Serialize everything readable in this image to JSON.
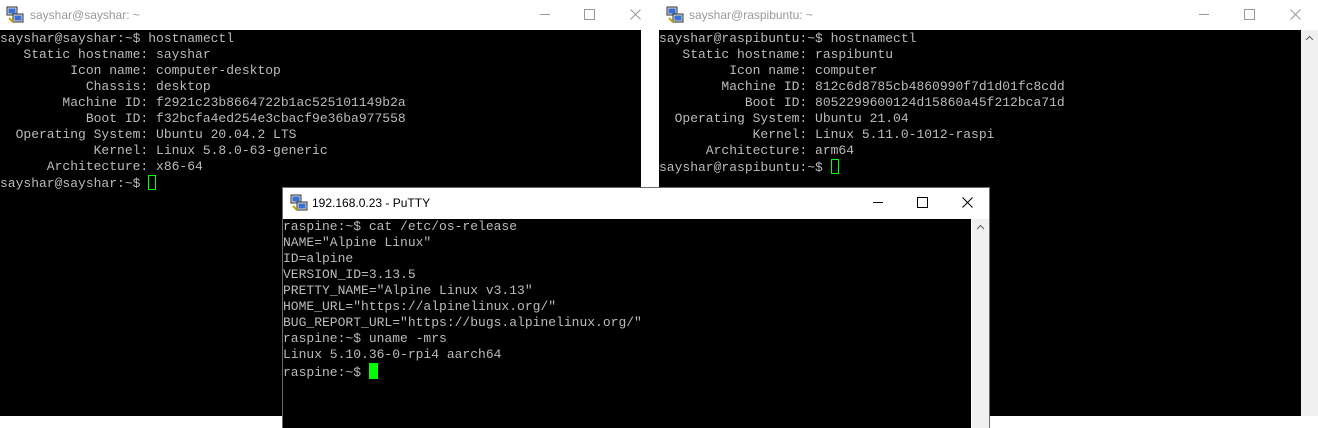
{
  "windows": {
    "left": {
      "title": "sayshar@sayshar: ~",
      "lines": [
        "sayshar@sayshar:~$ hostnamectl",
        "   Static hostname: sayshar",
        "         Icon name: computer-desktop",
        "           Chassis: desktop",
        "        Machine ID: f2921c23b8664722b1ac525101149b2a",
        "           Boot ID: f32bcfa4ed254e3cbacf9e36ba977558",
        "  Operating System: Ubuntu 20.04.2 LTS",
        "            Kernel: Linux 5.8.0-63-generic",
        "      Architecture: x86-64"
      ],
      "prompt": "sayshar@sayshar:~$ "
    },
    "right": {
      "title": "sayshar@raspibuntu: ~",
      "lines": [
        "sayshar@raspibuntu:~$ hostnamectl",
        "   Static hostname: raspibuntu",
        "         Icon name: computer",
        "        Machine ID: 812c6d8785cb4860990f7d1d01fc8cdd",
        "           Boot ID: 8052299600124d15860a45f212bca71d",
        "  Operating System: Ubuntu 21.04",
        "            Kernel: Linux 5.11.0-1012-raspi",
        "      Architecture: arm64"
      ],
      "prompt": "sayshar@raspibuntu:~$ "
    },
    "putty": {
      "title": "192.168.0.23 - PuTTY",
      "lines": [
        "raspine:~$ cat /etc/os-release",
        "NAME=\"Alpine Linux\"",
        "ID=alpine",
        "VERSION_ID=3.13.5",
        "PRETTY_NAME=\"Alpine Linux v3.13\"",
        "HOME_URL=\"https://alpinelinux.org/\"",
        "BUG_REPORT_URL=\"https://bugs.alpinelinux.org/\"",
        "raspine:~$ uname -mrs",
        "Linux 5.10.36-0-rpi4 aarch64"
      ],
      "prompt": "raspine:~$ "
    }
  },
  "icons": {
    "app": "putty-icon",
    "minimize": "minimize-icon",
    "maximize": "maximize-icon",
    "close": "close-icon"
  },
  "colors": {
    "terminal_bg": "#000000",
    "terminal_text": "#bbbbbb",
    "cursor": "#00ff00"
  }
}
